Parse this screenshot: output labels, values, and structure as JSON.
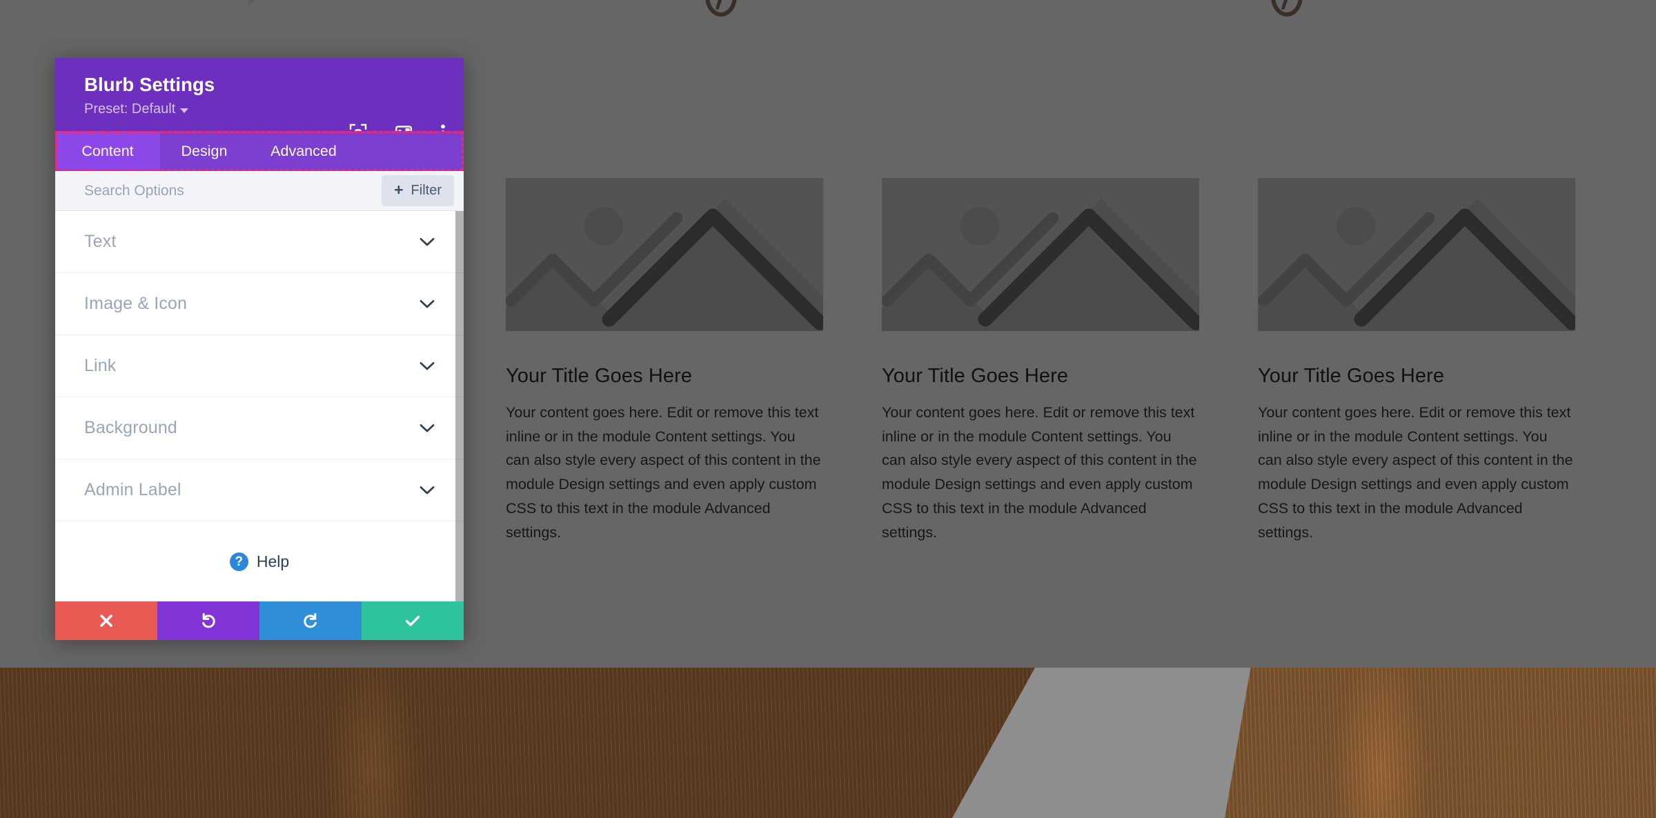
{
  "modal": {
    "title": "Blurb Settings",
    "preset_label": "Preset: Default",
    "header_icons": [
      {
        "name": "focus-expand-icon",
        "label": "Focus"
      },
      {
        "name": "layout-panel-icon",
        "label": "Layout"
      },
      {
        "name": "more-options-icon",
        "label": "More Options"
      }
    ],
    "tabs": [
      {
        "label": "Content",
        "active": true
      },
      {
        "label": "Design",
        "active": false
      },
      {
        "label": "Advanced",
        "active": false
      }
    ],
    "search": {
      "placeholder": "Search Options",
      "value": ""
    },
    "filter_button": {
      "label": "Filter",
      "plus": "+"
    },
    "sections": [
      {
        "label": "Text"
      },
      {
        "label": "Image & Icon"
      },
      {
        "label": "Link"
      },
      {
        "label": "Background"
      },
      {
        "label": "Admin Label"
      }
    ],
    "help": {
      "label": "Help",
      "icon_glyph": "?"
    },
    "footer_buttons": [
      {
        "name": "cancel-button",
        "icon": "close-icon",
        "glyph": "✕"
      },
      {
        "name": "undo-button",
        "icon": "undo-icon",
        "glyph": "↺"
      },
      {
        "name": "redo-button",
        "icon": "redo-icon",
        "glyph": "↻"
      },
      {
        "name": "save-button",
        "icon": "checkmark-icon",
        "glyph": "✓"
      }
    ]
  },
  "page": {
    "blurbs": [
      {
        "title": "Your Title Goes Here",
        "body": "Your content goes here. Edit or remove this text inline or in the module Content settings. You can also style every aspect of this content in the module Design settings and even apply custom CSS to this text in the module Advanced settings."
      },
      {
        "title": "Your Title Goes Here",
        "body": "Your content goes here. Edit or remove this text inline or in the module Content settings. You can also style every aspect of this content in the module Design settings and even apply custom CSS to this text in the module Advanced settings."
      },
      {
        "title": "Your Title Goes Here",
        "body": "Your content goes here. Edit or remove this text inline or in the module Content settings. You can also style every aspect of this content in the module Design settings and even apply custom CSS to this text in the module Advanced settings."
      }
    ]
  },
  "colors": {
    "header_purple": "#6d2fbd",
    "tabbar_purple": "#7c3fd0",
    "active_tab_purple": "#8c47e8",
    "highlight_outline": "#f4256e",
    "cancel_red": "#ea5a55",
    "undo_purple": "#8234d6",
    "redo_blue": "#2f8fd8",
    "save_green": "#2dc39c",
    "help_blue": "#2b87da",
    "overlay_gray": "#6b6b6b"
  }
}
